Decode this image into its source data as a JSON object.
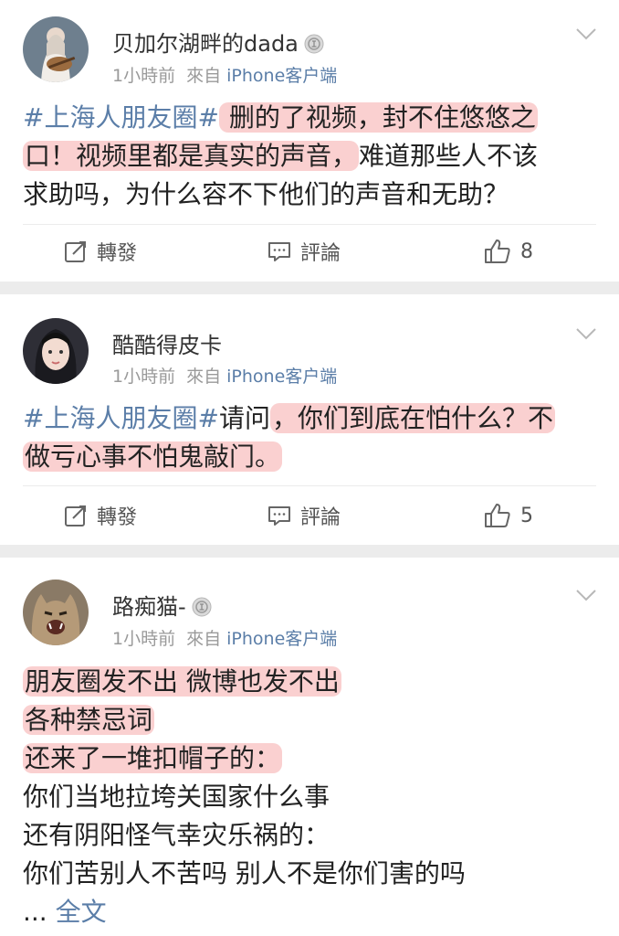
{
  "colors": {
    "link": "#5b7ea8",
    "highlight": "#f6aaaa",
    "separator": "#ececec"
  },
  "ui": {
    "repost": "轉發",
    "comment": "評論",
    "time": "1小時前",
    "source_prefix": "來自",
    "device": "iPhone客户端"
  },
  "posts": [
    {
      "username": "贝加尔湖畔的dada",
      "has_medal": true,
      "likes": "8",
      "lines": [
        [
          {
            "t": "#上海人朋友圈#",
            "tag": true
          },
          {
            "t": " 删的了视频，封不住悠悠之",
            "hl": true
          }
        ],
        [
          {
            "t": "口！视频里都是真实的声音，",
            "hl": true
          },
          {
            "t": "难道那些人不该"
          }
        ],
        [
          {
            "t": "求助吗，为什么容不下他们的声音和无助？"
          }
        ]
      ]
    },
    {
      "username": "酷酷得皮卡",
      "has_medal": false,
      "likes": "5",
      "lines": [
        [
          {
            "t": "#上海人朋友圈#",
            "tag": true
          },
          {
            "t": "请问"
          },
          {
            "t": "，你们到底在怕什么？不",
            "hl": true
          }
        ],
        [
          {
            "t": "做亏心事不怕鬼敲门。",
            "hl": true
          }
        ]
      ]
    },
    {
      "username": "路痴猫-",
      "has_medal": true,
      "lines": [
        [
          {
            "t": "朋友圈发不出 微博也发不出  ",
            "hl": true
          }
        ],
        [
          {
            "t": "各种禁忌词  ",
            "hl": true
          }
        ],
        [
          {
            "t": "还来了一堆扣帽子的：  ",
            "hl": true
          }
        ],
        [
          {
            "t": "你们当地拉垮关国家什么事"
          }
        ],
        [
          {
            "t": "还有阴阳怪气幸灾乐祸的："
          }
        ],
        [
          {
            "t": "你们苦别人不苦吗 别人不是你们害的吗"
          }
        ],
        [
          {
            "t": "... "
          },
          {
            "t": "全文",
            "more": true
          }
        ]
      ]
    }
  ]
}
